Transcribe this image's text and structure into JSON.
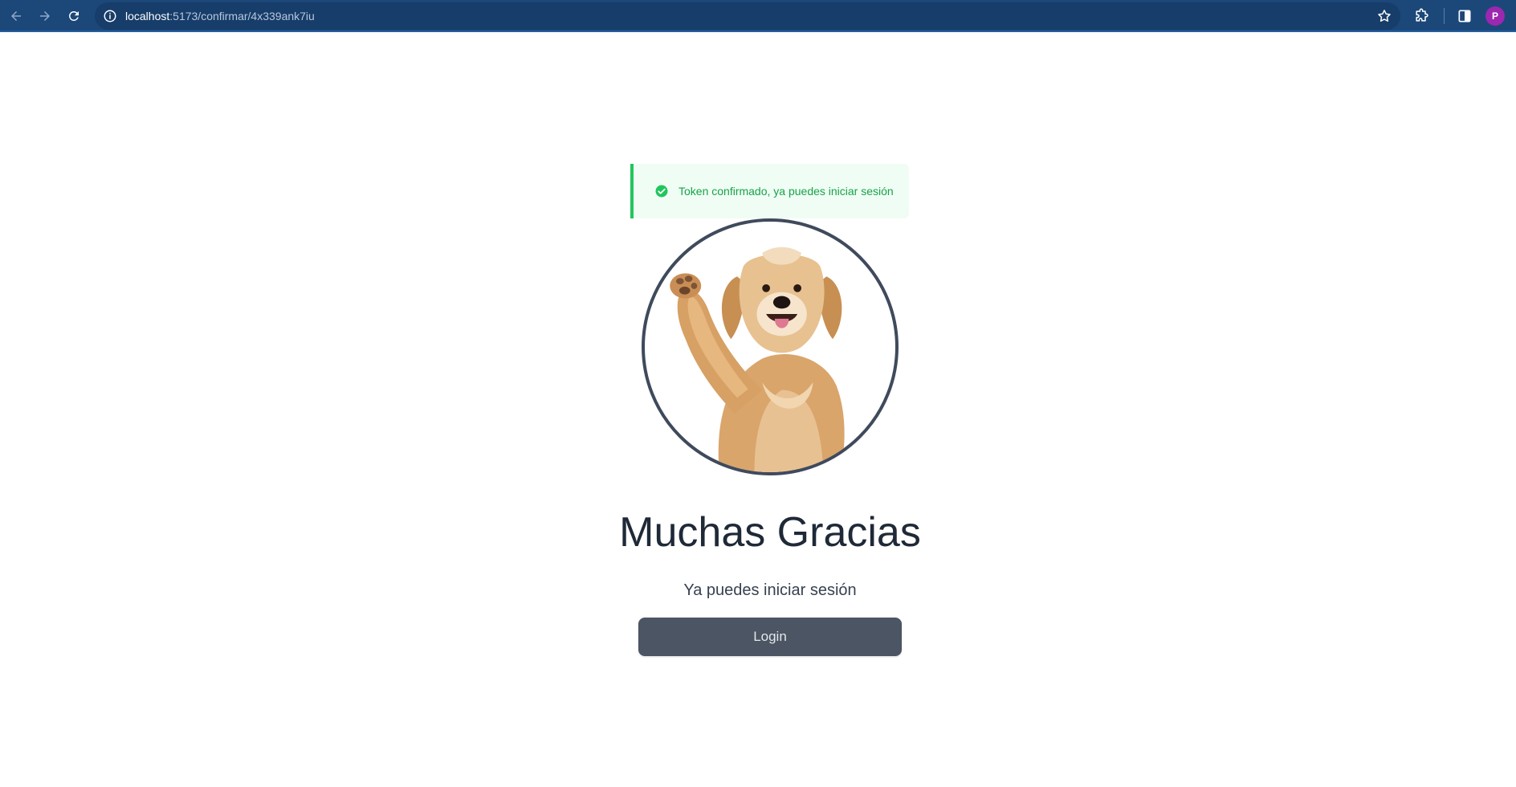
{
  "browser": {
    "url_host": "localhost",
    "url_path": ":5173/confirmar/4x339ank7iu",
    "avatar_initial": "P",
    "icons": {
      "back": "arrow-left-icon",
      "forward": "arrow-right-icon",
      "reload": "reload-icon",
      "site_info": "info-icon",
      "bookmark": "star-icon",
      "extensions": "puzzle-icon",
      "side_panel": "side-panel-icon"
    },
    "colors": {
      "toolbar": "#1c4779",
      "omnibox": "#173d6a",
      "avatar": "#9c27b0"
    }
  },
  "alert": {
    "text": "Token confirmado, ya puedes iniciar sesión",
    "icon": "check-circle-icon",
    "color": "#16a34a",
    "background": "#f0fdf4",
    "border": "#22c55e"
  },
  "hero": {
    "image": "golden-retriever-waving"
  },
  "content": {
    "title": "Muchas Gracias",
    "subtitle": "Ya puedes iniciar sesión",
    "login_label": "Login",
    "button_color": "#4b5563"
  }
}
